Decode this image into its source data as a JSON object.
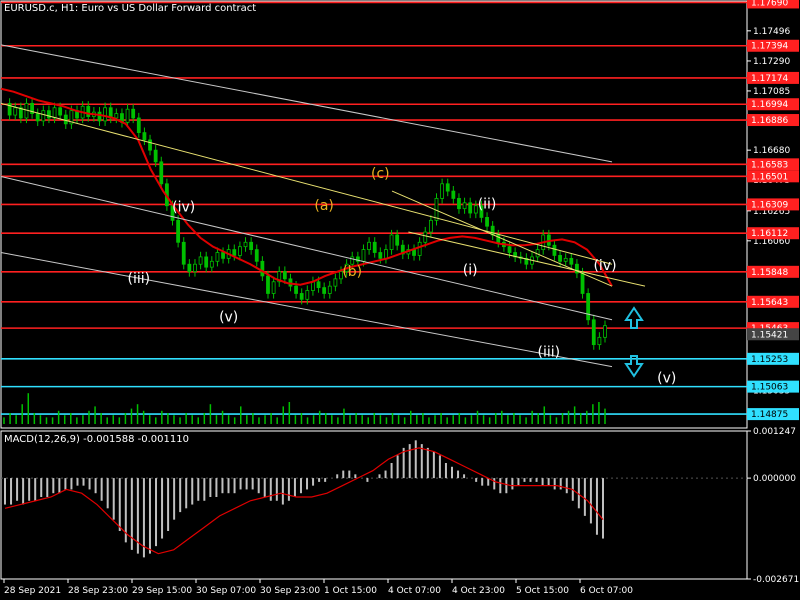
{
  "header": {
    "title": "EURUSD.c, H1:  Euro vs US Dollar Forward contract"
  },
  "macd_header": {
    "label": "MACD(12,26,9) -0.001588 -0.001110"
  },
  "colors": {
    "background": "#000000",
    "candle": "#00c000",
    "ma": "#e00000",
    "level_red": "#ff2020",
    "level_cyan": "#30e0ff",
    "channel": "#c8c8c8",
    "trend_yellow": "#e8e070",
    "wave_orange": "#e8b020",
    "wave_white": "#ffffff",
    "arrow_up": "#20c0e0",
    "arrow_down": "#20c0e0",
    "histogram": "#c0c0c0",
    "signal": "#e00000",
    "axis_text": "#ffffff"
  },
  "chart_data": [
    {
      "type": "line",
      "panel": "price",
      "ylim": [
        1.1478,
        1.177
      ],
      "x_ticks": [
        "28 Sep 2021",
        "28 Sep 23:00",
        "29 Sep 15:00",
        "30 Sep 07:00",
        "30 Sep 23:00",
        "1 Oct 15:00",
        "4 Oct 07:00",
        "4 Oct 23:00",
        "5 Oct 15:00",
        "6 Oct 07:00"
      ],
      "y_ticks": [
        "1.17496",
        "1.17290",
        "1.17085",
        "1.16886",
        "1.16680",
        "1.16475",
        "1.16265",
        "1.16060",
        "1.15855",
        "1.15643",
        "1.15440",
        "1.15253",
        "1.15035",
        "1.14875"
      ],
      "current_price": "1.15421",
      "levels": [
        {
          "value": "1.17690",
          "color": "red"
        },
        {
          "value": "1.17394",
          "color": "red"
        },
        {
          "value": "1.17174",
          "color": "red"
        },
        {
          "value": "1.16994",
          "color": "red"
        },
        {
          "value": "1.16886",
          "color": "red"
        },
        {
          "value": "1.16583",
          "color": "red"
        },
        {
          "value": "1.16501",
          "color": "red"
        },
        {
          "value": "1.16309",
          "color": "red"
        },
        {
          "value": "1.16112",
          "color": "red"
        },
        {
          "value": "1.15848",
          "color": "red"
        },
        {
          "value": "1.15643",
          "color": "red"
        },
        {
          "value": "1.15463",
          "color": "red"
        },
        {
          "value": "1.15253",
          "color": "cyan"
        },
        {
          "value": "1.15063",
          "color": "cyan"
        },
        {
          "value": "1.14875",
          "color": "cyan"
        }
      ],
      "price_series": [
        1.17,
        1.1692,
        1.1697,
        1.169,
        1.17,
        1.1693,
        1.1688,
        1.1695,
        1.169,
        1.1697,
        1.1692,
        1.1686,
        1.1695,
        1.169,
        1.1698,
        1.1691,
        1.1694,
        1.1688,
        1.1697,
        1.169,
        1.1693,
        1.1687,
        1.1696,
        1.169,
        1.168,
        1.1675,
        1.1668,
        1.166,
        1.1645,
        1.163,
        1.162,
        1.1605,
        1.159,
        1.1585,
        1.159,
        1.1595,
        1.1588,
        1.1592,
        1.1598,
        1.1594,
        1.16,
        1.1596,
        1.1602,
        1.1605,
        1.16,
        1.1592,
        1.1582,
        1.157,
        1.1578,
        1.1585,
        1.158,
        1.1575,
        1.157,
        1.1566,
        1.1572,
        1.1578,
        1.1574,
        1.157,
        1.1575,
        1.158,
        1.1585,
        1.159,
        1.1595,
        1.1592,
        1.16,
        1.1605,
        1.1598,
        1.1594,
        1.16,
        1.161,
        1.1603,
        1.1597,
        1.16,
        1.1596,
        1.1605,
        1.1612,
        1.162,
        1.1635,
        1.1645,
        1.164,
        1.1635,
        1.1628,
        1.1632,
        1.1625,
        1.163,
        1.1622,
        1.1616,
        1.161,
        1.1605,
        1.1602,
        1.1598,
        1.1595,
        1.1594,
        1.159,
        1.1595,
        1.16,
        1.161,
        1.1603,
        1.1596,
        1.1592,
        1.1594,
        1.159,
        1.1584,
        1.157,
        1.1552,
        1.1535,
        1.154,
        1.1548
      ],
      "ma_series": [
        1.171,
        1.1708,
        1.1705,
        1.1702,
        1.17,
        1.1698,
        1.1695,
        1.1693,
        1.1692,
        1.169,
        1.1686,
        1.1675,
        1.1655,
        1.164,
        1.1628,
        1.1617,
        1.1608,
        1.1602,
        1.1598,
        1.1594,
        1.159,
        1.1585,
        1.158,
        1.1577,
        1.1576,
        1.1578,
        1.1582,
        1.1585,
        1.1588,
        1.159,
        1.1592,
        1.1594,
        1.1597,
        1.16,
        1.1603,
        1.1606,
        1.1608,
        1.1609,
        1.1608,
        1.1606,
        1.1604,
        1.1603,
        1.1603,
        1.1604,
        1.1606,
        1.1607,
        1.1605,
        1.16,
        1.159,
        1.1575
      ],
      "channels": [
        {
          "name": "",
          "from": [
            0,
            1.174
          ],
          "to": [
            1,
            1.166
          ]
        },
        {
          "name": "",
          "from": [
            0,
            1.165
          ],
          "to": [
            1,
            1.1552
          ]
        },
        {
          "name": "",
          "from": [
            0,
            1.1598
          ],
          "to": [
            1,
            1.152
          ]
        },
        {
          "name": "",
          "from": [
            0,
            1.17
          ],
          "to": [
            1,
            1.159
          ]
        },
        {
          "name": "",
          "from": [
            0.64,
            1.164
          ],
          "to": [
            1,
            1.1575
          ]
        }
      ],
      "wave_labels": [
        {
          "text": "(iv)",
          "color": "white",
          "x_index": 32,
          "y": 1.1626
        },
        {
          "text": "(iii)",
          "color": "white",
          "x_index": 24,
          "y": 1.1577
        },
        {
          "text": "(v)",
          "color": "white",
          "x_index": 40,
          "y": 1.1551
        },
        {
          "text": "(a)",
          "color": "orange",
          "x_index": 57,
          "y": 1.1627
        },
        {
          "text": "(b)",
          "color": "orange",
          "x_index": 62,
          "y": 1.1582
        },
        {
          "text": "(c)",
          "color": "orange",
          "x_index": 67,
          "y": 1.1649
        },
        {
          "text": "(ii)",
          "color": "white",
          "x_index": 86,
          "y": 1.1628
        },
        {
          "text": "(i)",
          "color": "white",
          "x_index": 83,
          "y": 1.1583
        },
        {
          "text": "(iv)",
          "color": "white",
          "x_index": 107,
          "y": 1.1586
        },
        {
          "text": "(iii)",
          "color": "white",
          "x_index": 97,
          "y": 1.1527
        },
        {
          "text": "(v)",
          "color": "white",
          "x_index": 118,
          "y": 1.1509
        }
      ]
    },
    {
      "type": "bar",
      "panel": "volume",
      "values": [
        3,
        5,
        4,
        9,
        14,
        5,
        4,
        3,
        3,
        6,
        4,
        5,
        3,
        4,
        6,
        8,
        5,
        3,
        4,
        3,
        5,
        7,
        9,
        6,
        4,
        3,
        6,
        5,
        4,
        3,
        5,
        4,
        3,
        5,
        9,
        4,
        6,
        4,
        3,
        8,
        4,
        5,
        3,
        4,
        5,
        3,
        8,
        10,
        4,
        5,
        3,
        4,
        6,
        5,
        4,
        3,
        7,
        4,
        5,
        4,
        3,
        5,
        4,
        3,
        5,
        4,
        3,
        6,
        4,
        5,
        3,
        4,
        5,
        3,
        4,
        5,
        3,
        4,
        6,
        4,
        3,
        5,
        6,
        4,
        5,
        4,
        3,
        6,
        5,
        8,
        4,
        3,
        5,
        6,
        8,
        5,
        6,
        9,
        10,
        7
      ]
    },
    {
      "type": "bar",
      "panel": "macd",
      "ylim": [
        -0.002671,
        0.001247
      ],
      "y_ticks": [
        "0.001247",
        "0.000000",
        "-0.002671"
      ],
      "histogram": [
        -0.0007,
        -0.0007,
        -0.0006,
        -0.0007,
        -0.0006,
        -0.0006,
        -0.0005,
        -0.0005,
        -0.0004,
        -0.0004,
        -0.0003,
        -0.0003,
        -0.0002,
        -0.0002,
        -0.0003,
        -0.0004,
        -0.0006,
        -0.0008,
        -0.0011,
        -0.0014,
        -0.0017,
        -0.0019,
        -0.002,
        -0.0021,
        -0.002,
        -0.0018,
        -0.0016,
        -0.0014,
        -0.0011,
        -0.0009,
        -0.0008,
        -0.0007,
        -0.0006,
        -0.0006,
        -0.0005,
        -0.0005,
        -0.0004,
        -0.0004,
        -0.0004,
        -0.0003,
        -0.0003,
        -0.0003,
        -0.0004,
        -0.0005,
        -0.0006,
        -0.0006,
        -0.0007,
        -0.0006,
        -0.0005,
        -0.0004,
        -0.0003,
        -0.0002,
        -0.0001,
        -0.0001,
        0.0,
        0.0001,
        0.0002,
        0.0002,
        0.0001,
        0.0,
        -0.0001,
        0.0,
        0.0001,
        0.0002,
        0.0004,
        0.0006,
        0.0008,
        0.0009,
        0.001,
        0.0009,
        0.0008,
        0.0007,
        0.0006,
        0.0004,
        0.0003,
        0.0002,
        0.0001,
        0.0,
        -0.0001,
        -0.0002,
        -0.0002,
        -0.0003,
        -0.0004,
        -0.0004,
        -0.0003,
        -0.0002,
        -0.0001,
        -0.0001,
        -0.0001,
        -0.0002,
        -0.0002,
        -0.0003,
        -0.0003,
        -0.0004,
        -0.0006,
        -0.0008,
        -0.001,
        -0.0012,
        -0.0015,
        -0.0016
      ],
      "signal": [
        -0.0008,
        -0.0007,
        -0.0006,
        -0.0005,
        -0.0003,
        -0.0004,
        -0.0007,
        -0.0011,
        -0.0015,
        -0.0018,
        -0.002,
        -0.0019,
        -0.0016,
        -0.0013,
        -0.001,
        -0.0008,
        -0.0006,
        -0.0005,
        -0.0004,
        -0.0005,
        -0.0005,
        -0.0004,
        -0.0002,
        0.0,
        0.0002,
        0.0005,
        0.0007,
        0.0008,
        0.0007,
        0.0005,
        0.0003,
        0.0001,
        -0.0001,
        -0.0002,
        -0.0002,
        -0.0002,
        -0.0002,
        -0.0003,
        -0.0006,
        -0.0011
      ]
    }
  ]
}
